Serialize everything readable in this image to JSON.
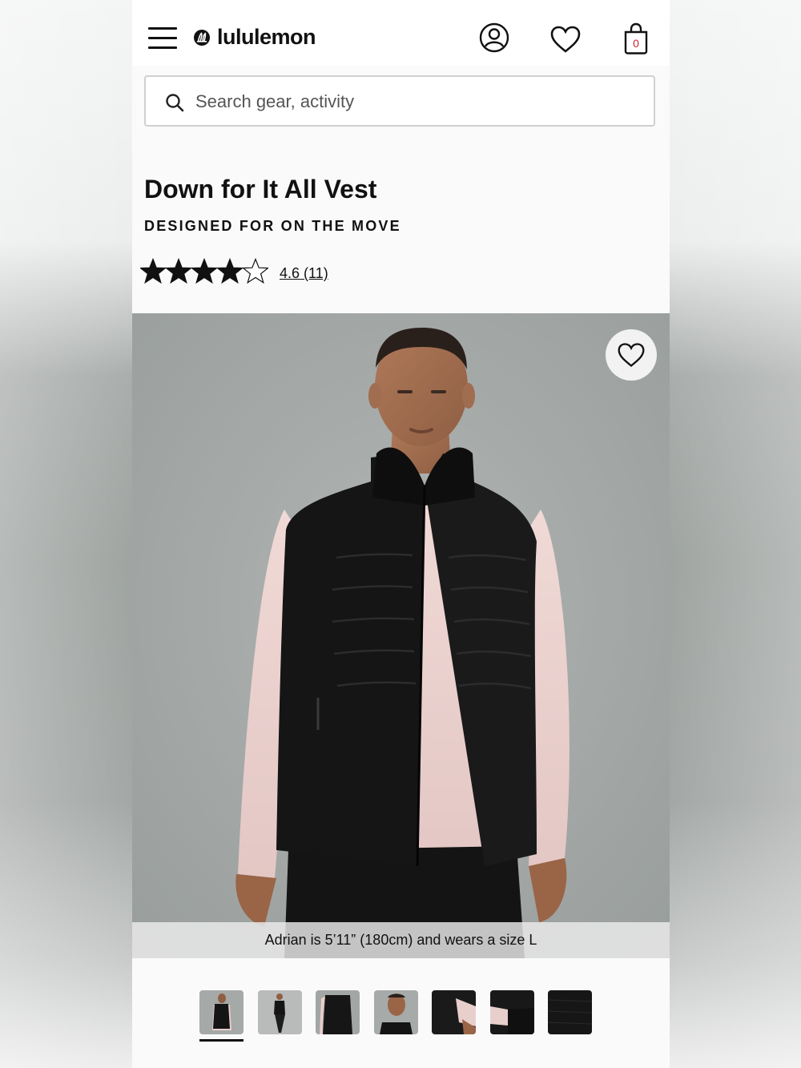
{
  "header": {
    "brand": "lululemon",
    "icons": [
      "menu-icon",
      "lululemon-logo-icon",
      "account-icon",
      "wishlist-heart-icon",
      "shopping-bag-icon"
    ],
    "bag_count": "0"
  },
  "search": {
    "placeholder": "Search gear, activity"
  },
  "product": {
    "title": "Down for It All Vest",
    "subtitle": "DESIGNED FOR ON THE MOVE",
    "rating": {
      "value": 4.6,
      "count": 11,
      "text": "4.6 (11)"
    }
  },
  "hero": {
    "caption": "Adrian is 5’11” (180cm) and wears a size L"
  },
  "gallery": {
    "thumbnail_count": 7,
    "selected_index": 0
  },
  "colors": {
    "accent": "#111111",
    "bag_badge": "#d22030",
    "hero_background": "#a2a6a4"
  }
}
